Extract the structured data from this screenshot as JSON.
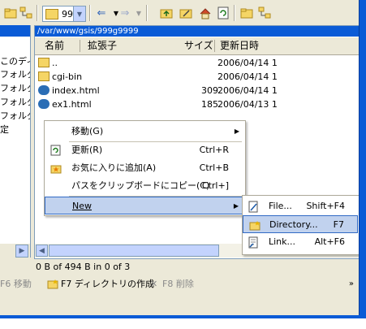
{
  "toolbar": {
    "combo_value": "99",
    "icons": [
      "folder-icon",
      "back-arrow-icon",
      "forward-arrow-icon",
      "up-folder-icon",
      "folder-edit-icon",
      "home-icon",
      "refresh-icon",
      "folder-icon",
      "tree-icon"
    ]
  },
  "left_pane": {
    "items": [
      "このディレ",
      "フォルダ",
      "フォルダ",
      "フォルダ",
      "フォルダ",
      "定"
    ]
  },
  "main_pane": {
    "path": "/var/www/gsis/999g9999",
    "columns": {
      "name": "名前",
      "ext": "拡張子",
      "size": "サイズ",
      "date": "更新日時"
    },
    "rows": [
      {
        "icon": "parent-folder-icon",
        "name": "..",
        "size": "",
        "date": "2006/04/14 1"
      },
      {
        "icon": "folder-icon",
        "name": "cgi-bin",
        "size": "",
        "date": "2006/04/14 1"
      },
      {
        "icon": "html-file-icon",
        "name": "index.html",
        "size": "309",
        "date": "2006/04/14 1"
      },
      {
        "icon": "html-file-icon",
        "name": "ex1.html",
        "size": "185",
        "date": "2006/04/13 1"
      }
    ]
  },
  "status": {
    "text": "0 B of 494 B in 0 of 3"
  },
  "function_bar": {
    "f6": "F6 移動",
    "f7": "F7 ディレクトリの作成",
    "f8": "F8 削除",
    "more": "»"
  },
  "context_menu": {
    "items": [
      {
        "label": "移動(G)",
        "shortcut": "",
        "submenu": true
      },
      {
        "label": "更新(R)",
        "shortcut": "Ctrl+R",
        "submenu": false
      },
      {
        "label": "お気に入りに追加(A)",
        "shortcut": "Ctrl+B",
        "submenu": false
      },
      {
        "label": "パスをクリップボードにコピー(C)",
        "shortcut": "Ctrl+]",
        "submenu": false
      },
      {
        "label": "New",
        "shortcut": "",
        "submenu": true
      }
    ]
  },
  "submenu": {
    "items": [
      {
        "label": "File...",
        "shortcut": "Shift+F4"
      },
      {
        "label": "Directory...",
        "shortcut": "F7"
      },
      {
        "label": "Link...",
        "shortcut": "Alt+F6"
      }
    ]
  },
  "colors": {
    "titlebar_blue": "#0a5bd6",
    "menu_highlight": "#c1d2ee",
    "menu_highlight_border": "#316ac5"
  }
}
